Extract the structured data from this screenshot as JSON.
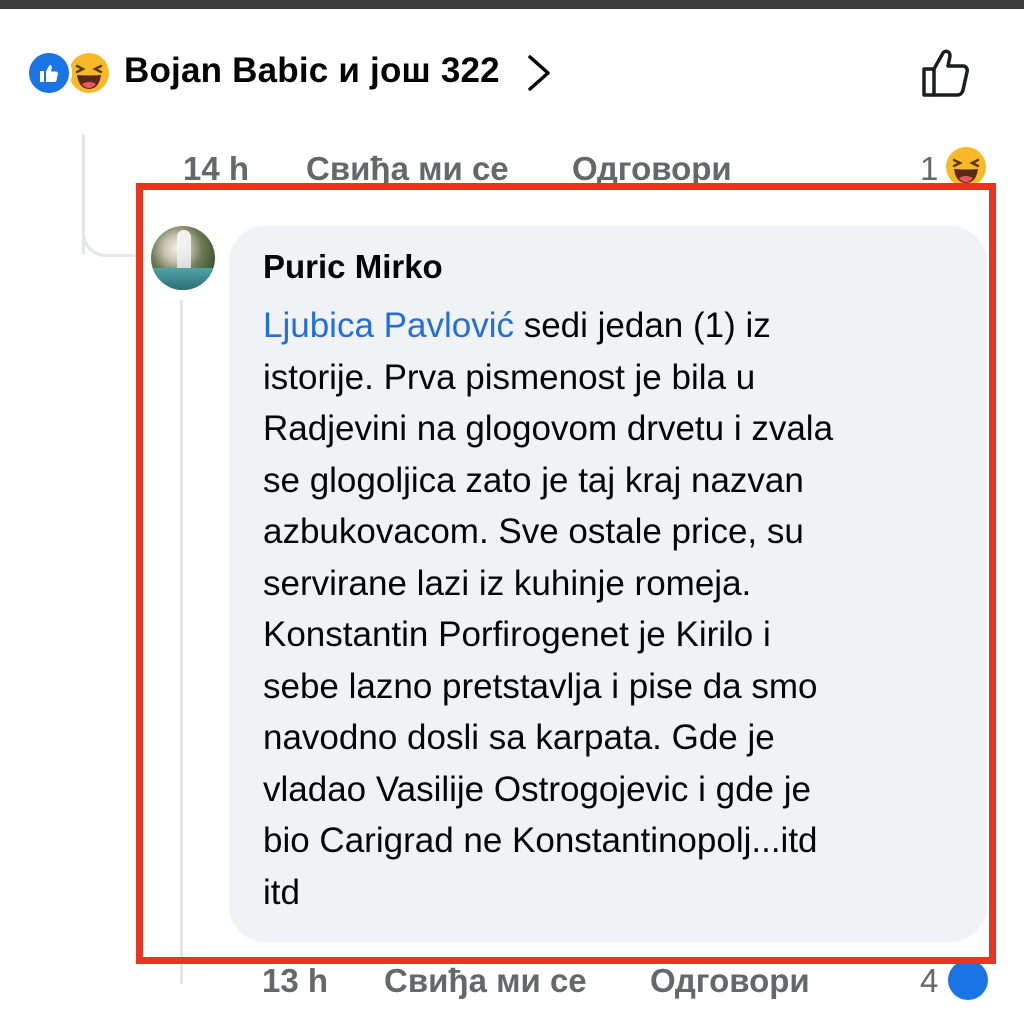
{
  "reactions_summary": {
    "text": "Bojan Babic и још 322",
    "icons": [
      "like-icon",
      "haha-icon"
    ]
  },
  "parent_comment_meta": {
    "time": "14 h",
    "like_label": "Свиђа ми се",
    "reply_label": "Одговори",
    "reaction_count": "1",
    "reaction_icon": "haha-icon"
  },
  "comment": {
    "author": "Puric Mirko",
    "mention": "Ljubica Pavlović",
    "lines": [
      " sedi jedan (1) iz",
      "istorije. Prva pismenost je bila u",
      "Radjevini na glogovom drvetu i zvala",
      "se glogoljica zato je taj kraj nazvan",
      "azbukovacom. Sve ostale price, su",
      "servirane lazi iz kuhinje romeja.",
      "Konstantin Porfirogenet je Kirilo i",
      "sebe lazno pretstavlja i pise da smo",
      "navodno dosli sa karpata. Gde je",
      "vladao Vasilije Ostrogojevic i gde je",
      "bio Carigrad ne Konstantinopolj...itd",
      "itd"
    ]
  },
  "comment_meta": {
    "time": "13 h",
    "like_label": "Свиђа ми се",
    "reply_label": "Одговори",
    "reaction_count": "4",
    "reaction_icon": "like-icon"
  },
  "colors": {
    "mention": "#216fdb",
    "bubble": "#f0f2f5",
    "highlight": "#e8351f",
    "meta_text": "#65676b",
    "like_blue": "#1b74e4"
  }
}
